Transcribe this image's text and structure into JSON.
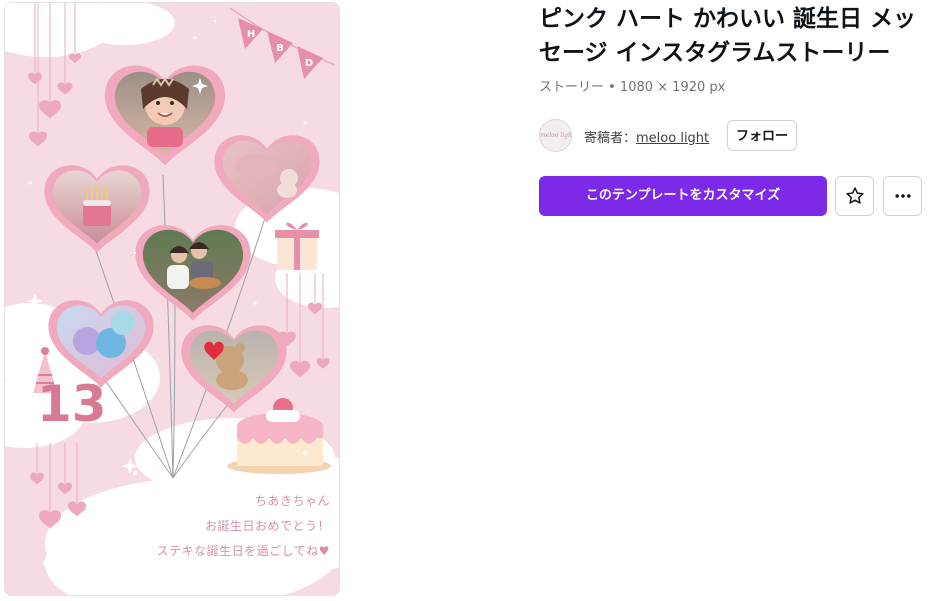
{
  "template": {
    "title": "ピンク ハート かわいい 誕生日 メッセージ インスタグラムストーリー",
    "meta": "ストーリー • 1080 × 1920 px"
  },
  "author": {
    "prefix": "寄稿者：",
    "name": "meloo light",
    "avatar_text": "meloo light"
  },
  "actions": {
    "follow_label": "フォロー",
    "customize_label": "このテンプレートをカスタマイズ",
    "favorite_icon": "star-icon",
    "more_icon": "more-dots-icon"
  },
  "preview": {
    "banner_letters": [
      "H",
      "B",
      "D"
    ],
    "age": "13",
    "message_lines": [
      "ちあきちゃん",
      "お誕生日おめでとう！",
      "ステキな誕生日を過ごしてね♥"
    ]
  },
  "colors": {
    "accent": "#7d2ae8",
    "preview_bg": "#f6dbe3",
    "heart_frame": "#f0a9bd",
    "message_text": "#d98ea6"
  }
}
